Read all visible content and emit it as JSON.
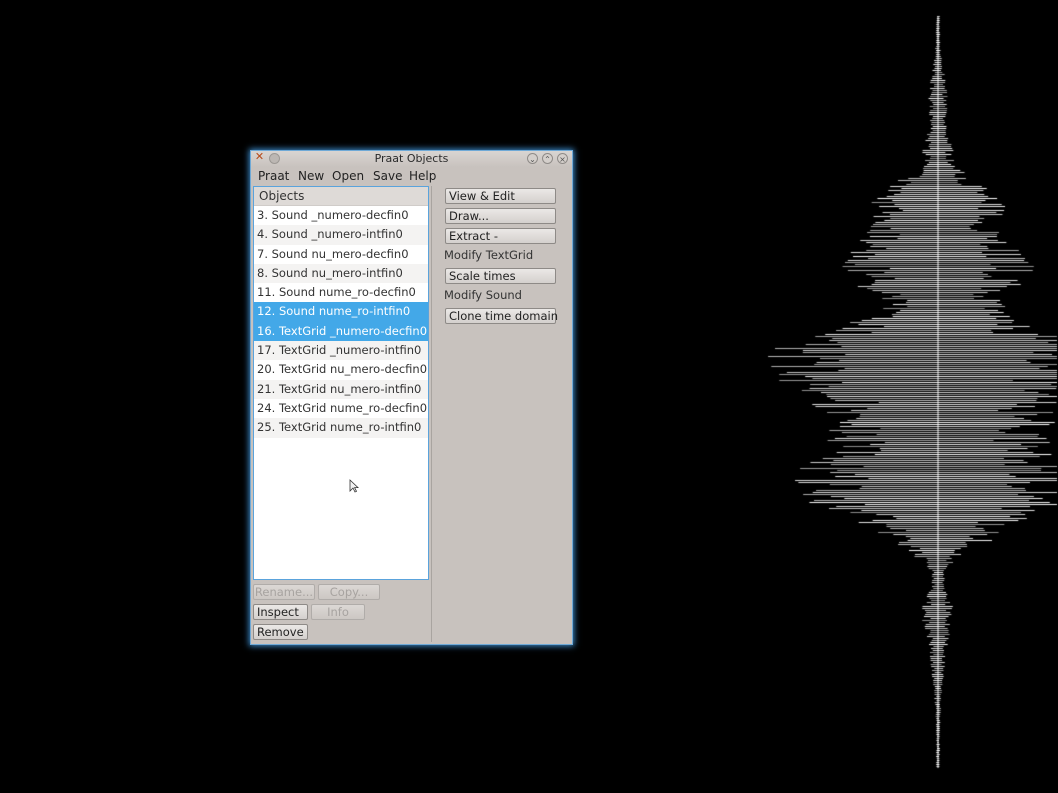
{
  "window": {
    "title": "Praat Objects",
    "menu": [
      "Praat",
      "New",
      "Open",
      "Save",
      "Help"
    ]
  },
  "objects_list": {
    "header": "Objects",
    "items": [
      {
        "label": "3. Sound _numero-decfin0",
        "selected": false
      },
      {
        "label": "4. Sound _numero-intfin0",
        "selected": false
      },
      {
        "label": "7. Sound nu_mero-decfin0",
        "selected": false
      },
      {
        "label": "8. Sound nu_mero-intfin0",
        "selected": false
      },
      {
        "label": "11. Sound nume_ro-decfin0",
        "selected": false
      },
      {
        "label": "12. Sound nume_ro-intfin0",
        "selected": true
      },
      {
        "label": "16. TextGrid _numero-decfin0",
        "selected": true
      },
      {
        "label": "17. TextGrid _numero-intfin0",
        "selected": false
      },
      {
        "label": "20. TextGrid nu_mero-decfin0",
        "selected": false
      },
      {
        "label": "21. TextGrid nu_mero-intfin0",
        "selected": false
      },
      {
        "label": "24. TextGrid nume_ro-decfin0",
        "selected": false
      },
      {
        "label": "25. TextGrid nume_ro-intfin0",
        "selected": false
      }
    ]
  },
  "bottom_buttons": {
    "rename": "Rename...",
    "copy": "Copy...",
    "inspect": "Inspect",
    "info": "Info",
    "remove": "Remove"
  },
  "action_panel": {
    "view_edit": "View & Edit",
    "draw": "Draw...",
    "extract": "Extract -",
    "modify_textgrid_label": "Modify TextGrid",
    "scale_times": "Scale times",
    "modify_sound_label": "Modify Sound",
    "clone_time_domain": "Clone time domain"
  },
  "colors": {
    "selection": "#43a8e8",
    "window_glow": "#3d8fd1",
    "desktop": "#000000"
  },
  "icons": [
    "close-icon",
    "minimize-dot-icon",
    "shade-icon",
    "maximize-icon",
    "window-close-icon",
    "mouse-pointer-icon"
  ]
}
